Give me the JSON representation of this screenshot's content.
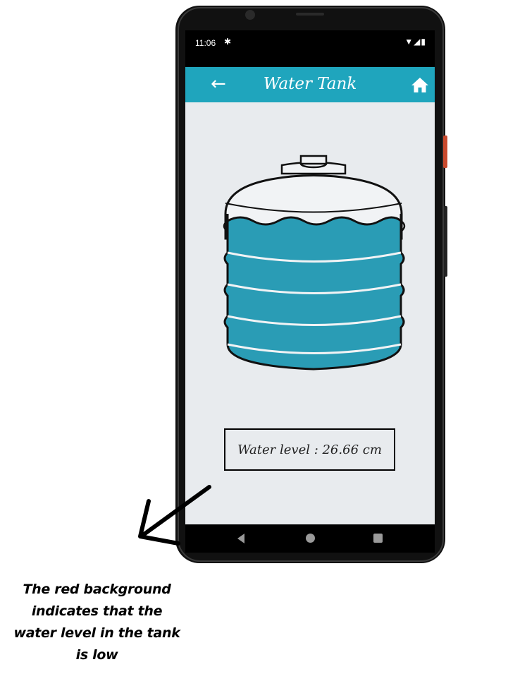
{
  "status_bar": {
    "time": "11:06",
    "settings_icon": "gear-icon",
    "right_icons": "wifi-icon signal-icon battery-icon"
  },
  "app_bar": {
    "back_icon": "back-arrow-icon",
    "title": "Water Tank",
    "home_icon": "home-icon",
    "color": "#1fa5bd"
  },
  "tank": {
    "water_color": "#2a9cb5"
  },
  "readout": {
    "text": "Water level : 26.66 cm"
  },
  "nav_bar": {
    "back": "nav-back-icon",
    "home": "nav-home-icon",
    "recents": "nav-recents-icon"
  },
  "annotation": {
    "caption_lines": [
      "The red background",
      "indicates that the",
      "water level in the tank",
      "is low"
    ]
  }
}
